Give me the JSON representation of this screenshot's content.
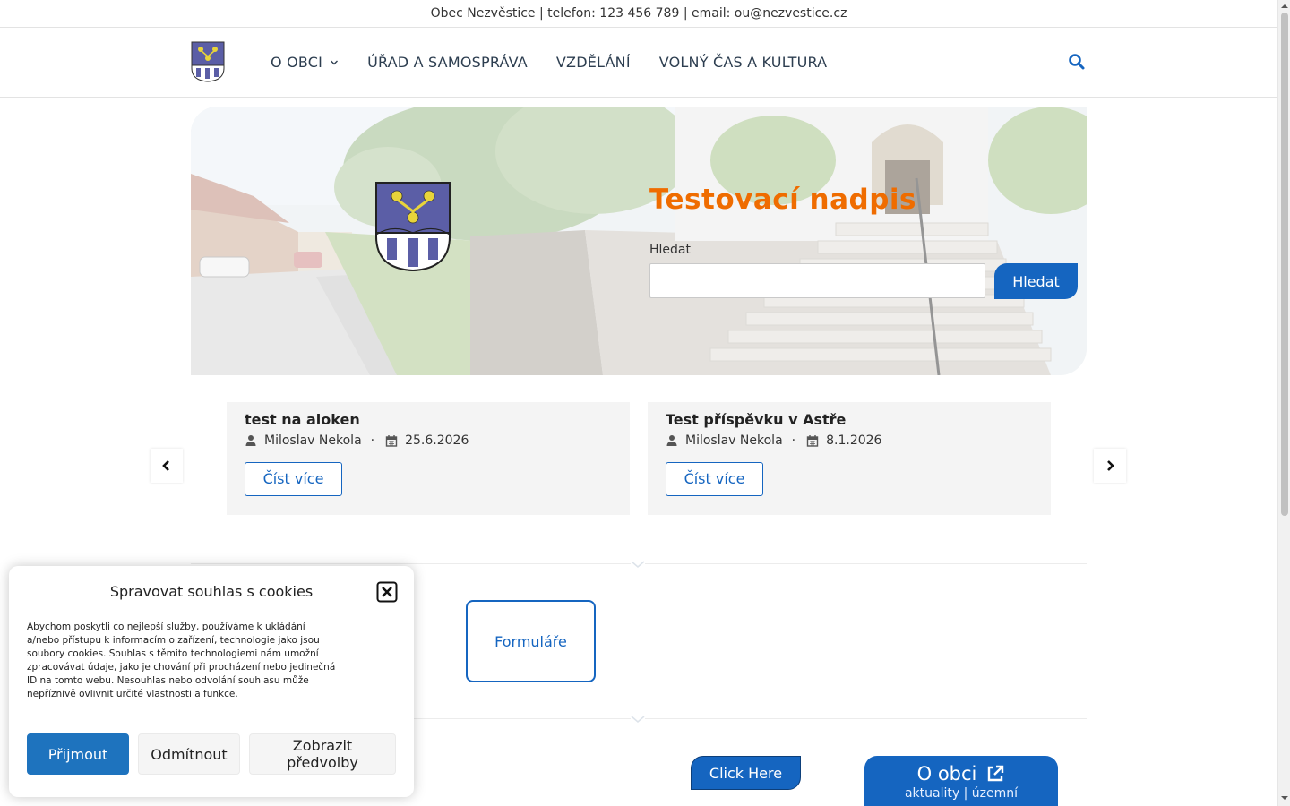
{
  "topbar": {
    "text": "Obec Nezvěstice | telefon: 123 456 789 | email: ou@nezvestice.cz"
  },
  "nav": {
    "items": [
      {
        "label": "O OBCI"
      },
      {
        "label": "ÚŘAD A SAMOSPRÁVA"
      },
      {
        "label": "VZDĚLÁNÍ"
      },
      {
        "label": "VOLNÝ ČAS A KULTURA"
      }
    ],
    "search_icon": "search-icon"
  },
  "hero": {
    "title": "Testovací nadpis",
    "search_label": "Hledat",
    "search_value": "",
    "search_button": "Hledat"
  },
  "posts": [
    {
      "title": "test na aloken",
      "author": "Miloslav Nekola",
      "date": "25.6.2026",
      "read_more": "Číst více"
    },
    {
      "title": "Test příspěvku v Astře",
      "author": "Miloslav Nekola",
      "date": "8.1.2026",
      "read_more": "Číst více"
    }
  ],
  "tiles": {
    "forms": "Formuláře",
    "click_here": "Click Here",
    "obec_title": "O obci",
    "obec_sub": "aktuality | územní"
  },
  "cookie": {
    "title": "Spravovat souhlas s cookies",
    "text": "Abychom poskytli co nejlepší služby, používáme k ukládání a/nebo přístupu k informacím o zařízení, technologie jako jsou soubory cookies. Souhlas s těmito technologiemi nám umožní zpracovávat údaje, jako je chování při procházení nebo jedinečná ID na tomto webu. Nesouhlas nebo odvolání souhlasu může nepříznivě ovlivnit určité vlastnosti a funkce.",
    "accept": "Přijmout",
    "deny": "Odmítnout",
    "preferences": "Zobrazit předvolby"
  },
  "colors": {
    "primary": "#1565c0",
    "hero_title": "#ef6c00",
    "coat_blue": "#5b5ea6",
    "coat_gold": "#e8d43a"
  }
}
